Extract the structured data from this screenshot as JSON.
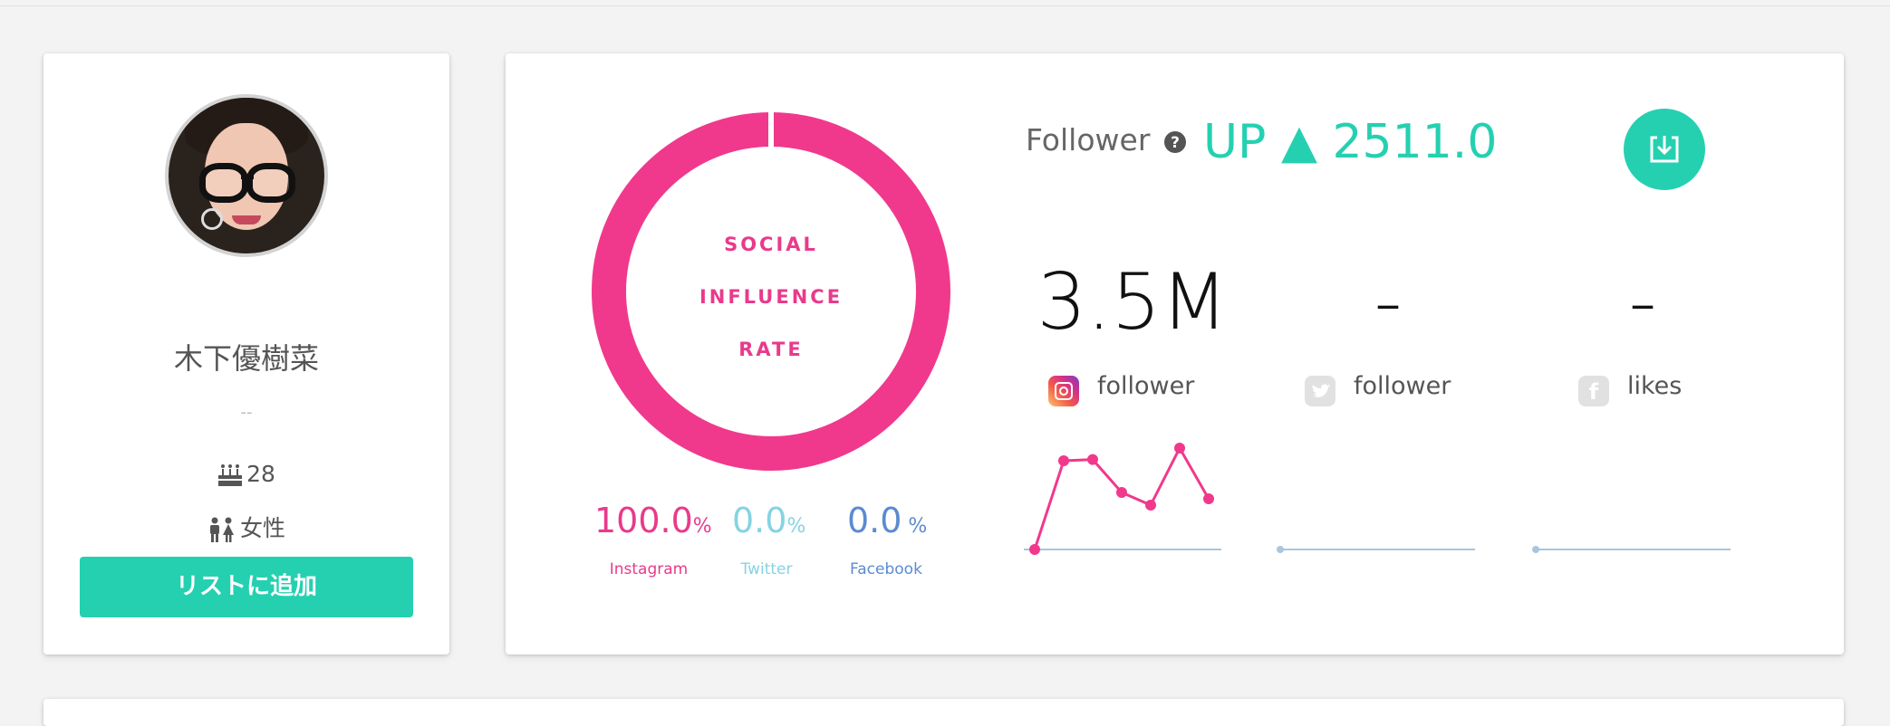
{
  "profile": {
    "name": "木下優樹菜",
    "subtitle": "--",
    "age": "28",
    "gender": "女性",
    "add_button": "リストに追加"
  },
  "influence": {
    "donut_lines": [
      "SOCIAL",
      "INFLUENCE",
      "RATE"
    ],
    "ring_color": "#f0398c",
    "shares": [
      {
        "value": "100.0",
        "unit": "%",
        "name": "Instagram",
        "color": "#e93a8b"
      },
      {
        "value": "0.0",
        "unit": "%",
        "name": "Twitter",
        "color": "#86d3e2"
      },
      {
        "value": "0.0",
        "unit": " %",
        "name": "Facebook",
        "color": "#5b8bd0"
      }
    ]
  },
  "growth": {
    "label": "Follower",
    "help_icon": "question-circle-icon",
    "trend_text": "UP ▲ 2511.0",
    "download_icon": "download-icon"
  },
  "platforms": [
    {
      "count": "3.5M",
      "label": "follower",
      "icon": "instagram-icon"
    },
    {
      "count": "-",
      "label": "follower",
      "icon": "twitter-icon"
    },
    {
      "count": "-",
      "label": "likes",
      "icon": "facebook-icon"
    }
  ],
  "chart_data": [
    {
      "type": "line",
      "series": [
        {
          "values": [
            0,
            7,
            7.1,
            4.5,
            3.5,
            8,
            4
          ]
        }
      ],
      "color": "#f0398c"
    },
    {
      "type": "line",
      "series": [
        {
          "values": []
        }
      ]
    },
    {
      "type": "line",
      "series": [
        {
          "values": []
        }
      ]
    }
  ]
}
